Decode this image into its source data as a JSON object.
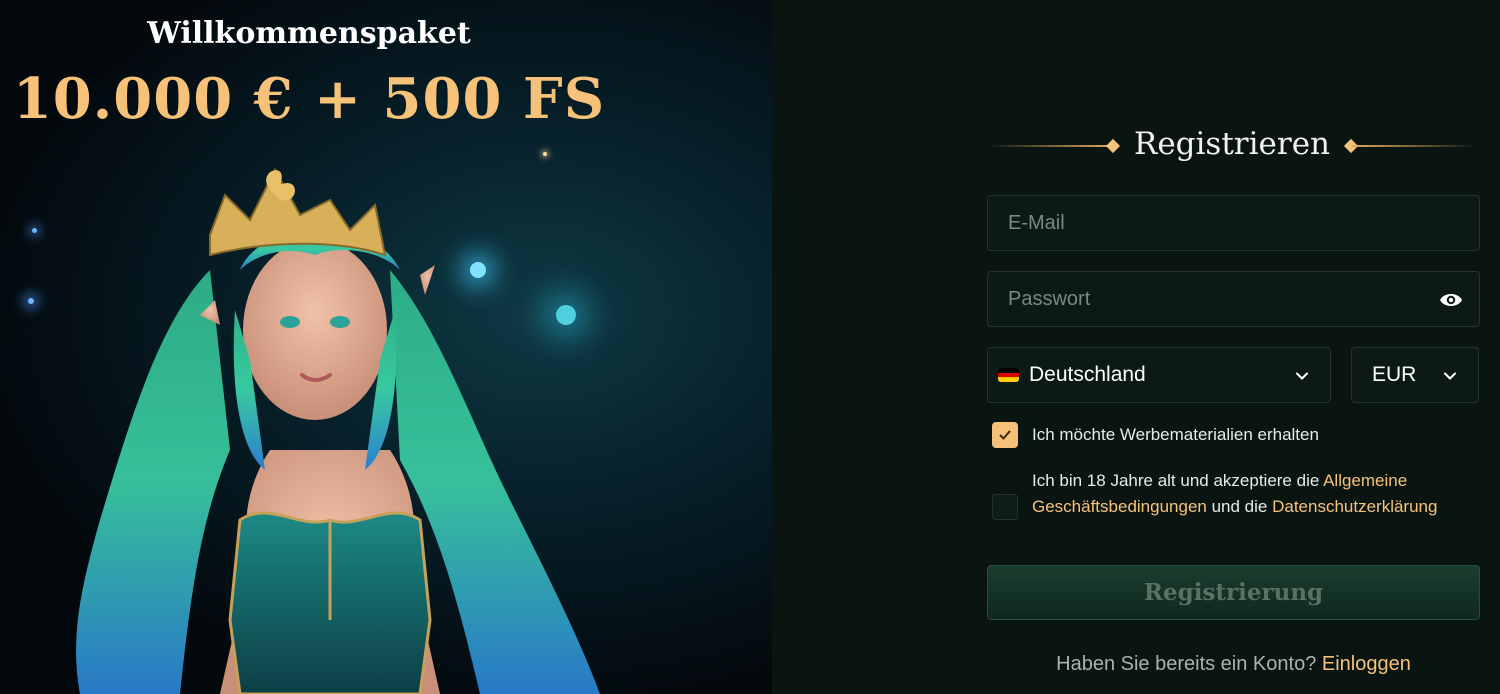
{
  "promo": {
    "title": "Willkommenspaket",
    "amount": "10.000 € + 500 FS"
  },
  "form": {
    "heading": "Registrieren",
    "email_placeholder": "E-Mail",
    "password_placeholder": "Passwort",
    "password_toggle_icon": "eye-icon",
    "country": {
      "value": "Deutschland",
      "flag_icon": "germany-flag-icon"
    },
    "currency": {
      "value": "EUR"
    },
    "marketing_checkbox": {
      "checked": true,
      "label": "Ich möchte Werbematerialien erhalten"
    },
    "terms_checkbox": {
      "checked": false,
      "text_before": "Ich bin 18 Jahre alt und akzeptiere die ",
      "terms_link": "Allgemeine Geschäftsbedingungen",
      "text_middle": " und die ",
      "privacy_link": "Datenschutzerklärung"
    },
    "submit_label": "Registrierung",
    "login_prompt": "Haben Sie bereits ein Konto?",
    "login_link": "Einloggen"
  },
  "colors": {
    "accent": "#f6c27a",
    "background": "#0a1512",
    "field_bg": "#0b1a17",
    "field_border": "#1f3530"
  }
}
